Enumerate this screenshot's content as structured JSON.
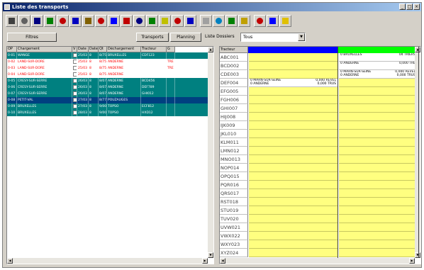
{
  "window": {
    "title": "Liste des transports",
    "buttons": [
      "_",
      "□",
      "×"
    ]
  },
  "toolbar": {
    "icons": [
      {
        "name": "save-icon",
        "color": "#404040"
      },
      {
        "name": "grid-icon",
        "color": "#606060"
      },
      {
        "name": "print-icon",
        "color": "#000080"
      },
      {
        "name": "truck-icon",
        "color": "#008000"
      },
      {
        "name": "delete-icon",
        "color": "#c00000"
      },
      {
        "name": "edit-icon",
        "color": "#0000c0"
      },
      {
        "name": "wand-icon",
        "color": "#806000"
      },
      {
        "name": "calendar-icon",
        "color": "#c00000"
      },
      {
        "name": "chart-icon",
        "color": "#0000ff"
      },
      {
        "name": "filter-icon",
        "color": "#c00000"
      },
      {
        "name": "minus-icon",
        "color": "#000080"
      },
      {
        "name": "check-icon",
        "color": "#008000"
      },
      {
        "name": "arrow-icon",
        "color": "#c0c000"
      },
      {
        "name": "cross-icon",
        "color": "#c00000"
      },
      {
        "name": "split-icon",
        "color": "#0000c0"
      },
      {
        "name": "funnel-icon",
        "color": "#a0a0a0"
      },
      {
        "name": "table-icon",
        "color": "#0080c0"
      },
      {
        "name": "leaf-icon",
        "color": "#008000"
      },
      {
        "name": "map-icon",
        "color": "#c0a000"
      },
      {
        "name": "diamond-icon",
        "color": "#c00000"
      },
      {
        "name": "globe-icon",
        "color": "#0000ff"
      },
      {
        "name": "help-icon",
        "color": "#e0c000"
      }
    ]
  },
  "buttonbar": {
    "filter_label": "Filtres",
    "transports_label": "Transports",
    "planning_label": "Planning",
    "list_label": "Liste Dossiers",
    "combo_value": "Tous"
  },
  "left": {
    "columns": [
      "OP",
      "Chargement",
      "V",
      "Date",
      "Date",
      "Qt",
      "Déchargement",
      "Tracteur",
      "G"
    ],
    "rows": [
      {
        "op": "0-01",
        "charg": "WANGE",
        "date1": "25/03",
        "date2": "8",
        "qt": "8/75",
        "dech": "BRUXELLES",
        "tract": "CDF123",
        "g": "",
        "bg": "#008080",
        "fg": "#ffffff"
      },
      {
        "op": "0-02",
        "charg": "LAND-SUR-DORE",
        "date1": "25/03",
        "date2": "8",
        "qt": "8/75",
        "dech": "ANDERNE",
        "tract": "",
        "g": "TRE",
        "bg": "#ffffff",
        "fg": "#ff0000"
      },
      {
        "op": "0-03",
        "charg": "LAND-SUR-DORE",
        "date1": "25/03",
        "date2": "8",
        "qt": "8/75",
        "dech": "ANDERNE",
        "tract": "",
        "g": "TRE",
        "bg": "#ffffff",
        "fg": "#ff0000"
      },
      {
        "op": "0-04",
        "charg": "LAND-SUR-DORE",
        "date1": "25/03",
        "date2": "8",
        "qt": "8/75",
        "dech": "ANDERNE",
        "tract": "",
        "g": "",
        "bg": "#ffffff",
        "fg": "#ff0000"
      },
      {
        "op": "0-05",
        "charg": "CRESY-SUR-SERRE",
        "date1": "26/03",
        "date2": "8",
        "qt": "8/07",
        "dech": "ANDERNE",
        "tract": "BCD456",
        "g": "",
        "bg": "#008080",
        "fg": "#ffffff"
      },
      {
        "op": "0-06",
        "charg": "CRESY-SUR-SERRE",
        "date1": "26/03",
        "date2": "8",
        "qt": "8/07",
        "dech": "ANDERNE",
        "tract": "DEF789",
        "g": "",
        "bg": "#008080",
        "fg": "#ffffff"
      },
      {
        "op": "0-07",
        "charg": "CRESY-SUR-SERRE",
        "date1": "26/03",
        "date2": "8",
        "qt": "8/07",
        "dech": "ANDERNE",
        "tract": "GHI012",
        "g": "",
        "bg": "#008080",
        "fg": "#ffffff"
      },
      {
        "op": "0-08",
        "charg": "PETIT-VAL",
        "date1": "27/03",
        "date2": "8",
        "qt": "8/77",
        "dech": "POUZAUGES",
        "tract": "",
        "g": "",
        "bg": "#004080",
        "fg": "#ffffff"
      },
      {
        "op": "0-09",
        "charg": "BRUXELLES",
        "date1": "27/03",
        "date2": "8",
        "qt": "9/00",
        "dech": "TOPSO",
        "tract": "ECF812",
        "g": "",
        "bg": "#008080",
        "fg": "#ffffff"
      },
      {
        "op": "0-10",
        "charg": "BRUXELLES",
        "date1": "28/03",
        "date2": "8",
        "qt": "9/00",
        "dech": "TOPSO",
        "tract": "HXD12",
        "g": "",
        "bg": "#008080",
        "fg": "#ffffff"
      }
    ]
  },
  "right": {
    "header_label": "Tracteur",
    "col1_header": "",
    "col2_header": "",
    "col1_color": "#0000ff",
    "col2_color": "#00ff00",
    "row_labels": [
      "ABC001",
      "BCD002",
      "CDE003",
      "DEF004",
      "EFG005",
      "FGH006",
      "GHI007",
      "HIJ008",
      "IJK009",
      "JKL010",
      "KLM011",
      "LMN012",
      "MNO013",
      "NOP014",
      "OPQ015",
      "PQR016",
      "QRS017",
      "RST018",
      "STU019",
      "TUV020",
      "UVW021",
      "VWX022",
      "WXY023",
      "XYZ024"
    ],
    "white_cells": [
      {
        "row": 2,
        "col": 1,
        "lines": [
          "0 MARN-SUR-SEINE",
          "0 ANDERNE"
        ],
        "vals": [
          "0,000 REVEL",
          "0,000 TRUS"
        ]
      },
      {
        "row": 3,
        "col": 0,
        "lines": [
          "0 MARN-SUR-SEINE",
          "0 ANDERNE"
        ],
        "vals": [
          "0,000 REVEL",
          "0,000 TRUS"
        ]
      },
      {
        "row": 0,
        "col": 1,
        "lines": [
          "0 BRUXELLES"
        ],
        "vals": [
          "04 TRIERS"
        ]
      },
      {
        "row": 1,
        "col": 1,
        "lines": [
          "0 ANDERNE"
        ],
        "vals": [
          "0,000 TRE"
        ]
      },
      {
        "row": 2,
        "col": 1,
        "lines": [
          "0 TRIER"
        ],
        "vals": [
          "12 TRIERS"
        ]
      }
    ]
  }
}
